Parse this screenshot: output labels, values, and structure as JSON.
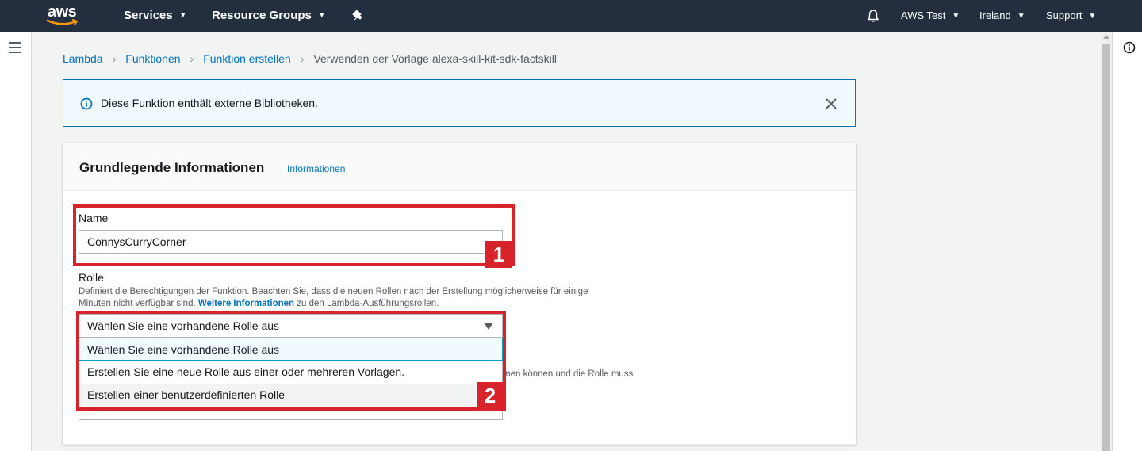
{
  "topnav": {
    "logo_text": "aws",
    "services_label": "Services",
    "resource_groups_label": "Resource Groups",
    "account_label": "AWS Test",
    "region_label": "Ireland",
    "support_label": "Support"
  },
  "breadcrumb": {
    "items": [
      "Lambda",
      "Funktionen",
      "Funktion erstellen"
    ],
    "current": "Verwenden der Vorlage alexa-skill-kit-sdk-factskill"
  },
  "alert": {
    "message": "Diese Funktion enthält externe Bibliotheken."
  },
  "panel": {
    "title": "Grundlegende Informationen",
    "info_link": "Informationen",
    "name_label": "Name",
    "name_value": "ConnysCurryCorner",
    "role_label": "Rolle",
    "role_desc_part1": "Definiert die Berechtigungen der Funktion. Beachten Sie, dass die neuen Rollen nach der Erstellung möglicherweise für einige",
    "role_desc_part2": "Minuten nicht verfügbar sind.",
    "role_desc_link": "Weitere Informationen",
    "role_desc_part3": "zu den Lambda-Ausführungsrollen.",
    "role_selected": "Wählen Sie eine vorhandene Rolle aus",
    "role_options": [
      "Wählen Sie eine vorhandene Rolle aus",
      "Erstellen Sie eine neue Rolle aus einer oder mehreren Vorlagen.",
      "Erstellen einer benutzerdefinierten Rolle"
    ],
    "obscured_desc_fragment": "men können und die Rolle muss"
  },
  "annotations": {
    "marker_1": "1",
    "marker_2": "2"
  },
  "colors": {
    "nav_bg": "#232f3e",
    "link": "#0073bb",
    "annotation_red": "#d8232a",
    "alert_bg": "#f1faff"
  }
}
